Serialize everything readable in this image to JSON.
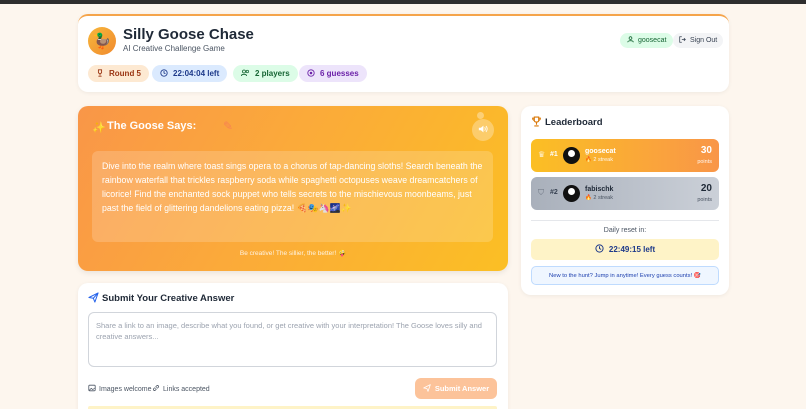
{
  "app": {
    "title": "Silly Goose Chase",
    "subtitle": "AI Creative Challenge Game",
    "logo_icon": "goose-icon"
  },
  "user": {
    "username": "goosecat",
    "signout_label": "Sign Out"
  },
  "stats": {
    "round": "Round 5",
    "time_left": "22:04:04 left",
    "players": "2 players",
    "guesses": "6 guesses"
  },
  "goose": {
    "title": "The Goose Says:",
    "prompt": "Dive into the realm where toast sings opera to a chorus of tap-dancing sloths! Search beneath the rainbow waterfall that trickles raspberry soda while spaghetti octopuses weave dreamcatchers of licorice! Find the enchanted sock puppet who tells secrets to the mischievous moonbeams, just past the field of glittering dandelions eating pizza! 🍕🎭🦄🌌✨",
    "footer": "Be creative! The sillier, the better! 🤪"
  },
  "submit": {
    "title": "Submit Your Creative Answer",
    "placeholder": "Share a link to an image, describe what you found, or get creative with your interpretation! The Goose loves silly and creative answers...",
    "images_label": "Images welcome",
    "links_label": "Links accepted",
    "button_label": "Submit Answer"
  },
  "leaderboard": {
    "title": "Leaderboard",
    "entries": [
      {
        "rank": "#1",
        "name": "goosecat",
        "streak": "2 streak",
        "points": "30",
        "points_label": "points"
      },
      {
        "rank": "#2",
        "name": "fabischk",
        "streak": "2 streak",
        "points": "20",
        "points_label": "points"
      }
    ],
    "reset_label": "Daily reset in:",
    "reset_time": "22:49:15 left",
    "info": "New to the hunt? Jump in anytime! Every guess counts! 🎯"
  },
  "colors": {
    "accent_orange": "#f99648",
    "accent_yellow": "#fbbf24",
    "background": "#fdf6ee"
  }
}
